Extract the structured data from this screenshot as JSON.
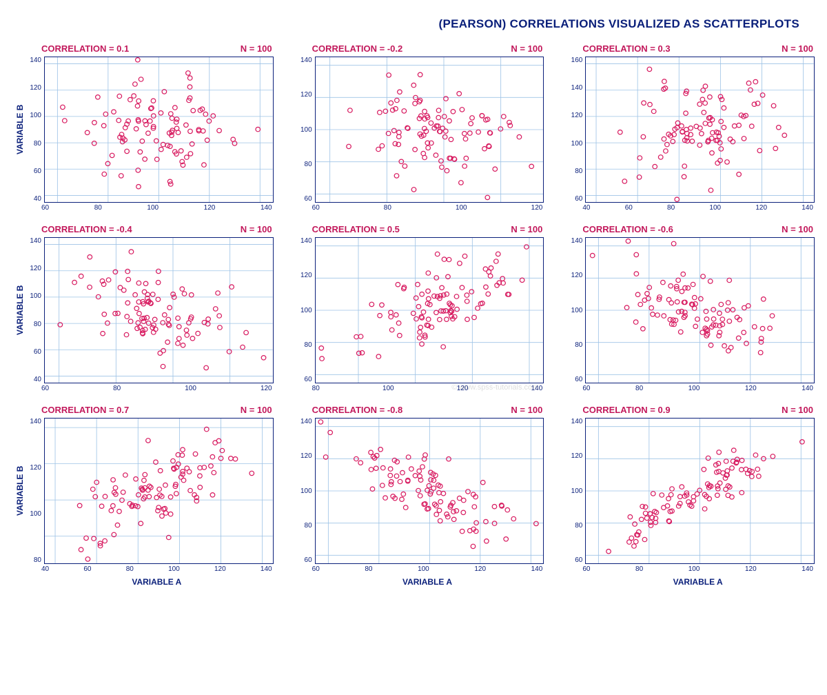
{
  "colors": {
    "text_primary": "#0a1f7a",
    "accent": "#c2185b",
    "grid": "#9ec3e6",
    "point_stroke": "#d81b60"
  },
  "main_title": "(PEARSON) CORRELATIONS VISUALIZED AS SCATTERPLOTS",
  "global_xlabel": "VARIABLE A",
  "global_ylabel": "VARIABLE B",
  "watermark": "© www.spss-tutorials.com",
  "chart_data": [
    {
      "type": "scatter",
      "title_left": "CORRELATION = 0.1",
      "title_right": "N = 100",
      "correlation": 0.1,
      "n": 100,
      "xlabel": "VARIABLE A",
      "ylabel": "VARIABLE B",
      "xlim": [
        55,
        145
      ],
      "ylim": [
        35,
        145
      ],
      "xticks": [
        60,
        80,
        100,
        120,
        140
      ],
      "yticks": [
        40,
        60,
        80,
        100,
        120,
        140
      ]
    },
    {
      "type": "scatter",
      "title_left": "CORRELATION = -0.2",
      "title_right": "N = 100",
      "correlation": -0.2,
      "n": 100,
      "xlabel": "VARIABLE A",
      "ylabel": "VARIABLE B",
      "xlim": [
        55,
        135
      ],
      "ylim": [
        55,
        145
      ],
      "xticks": [
        60,
        80,
        100,
        120
      ],
      "yticks": [
        60,
        80,
        100,
        120,
        140
      ]
    },
    {
      "type": "scatter",
      "title_left": "CORRELATION = 0.3",
      "title_right": "N = 100",
      "correlation": 0.3,
      "n": 100,
      "xlabel": "VARIABLE A",
      "ylabel": "VARIABLE B",
      "xlim": [
        35,
        145
      ],
      "ylim": [
        55,
        165
      ],
      "xticks": [
        40,
        60,
        80,
        100,
        120,
        140
      ],
      "yticks": [
        60,
        80,
        100,
        120,
        140,
        160
      ]
    },
    {
      "type": "scatter",
      "title_left": "CORRELATION = -0.4",
      "title_right": "N = 100",
      "correlation": -0.4,
      "n": 100,
      "xlabel": "VARIABLE A",
      "ylabel": "VARIABLE B",
      "xlim": [
        55,
        135
      ],
      "ylim": [
        35,
        145
      ],
      "xticks": [
        60,
        80,
        100,
        120
      ],
      "yticks": [
        40,
        60,
        80,
        100,
        120,
        140
      ]
    },
    {
      "type": "scatter",
      "title_left": "CORRELATION = 0.5",
      "title_right": "N = 100",
      "correlation": 0.5,
      "n": 100,
      "xlabel": "VARIABLE A",
      "ylabel": "VARIABLE B",
      "xlim": [
        65,
        145
      ],
      "ylim": [
        55,
        145
      ],
      "xticks": [
        80,
        100,
        120,
        140
      ],
      "yticks": [
        60,
        80,
        100,
        120,
        140
      ]
    },
    {
      "type": "scatter",
      "title_left": "CORRELATION = -0.6",
      "title_right": "N = 100",
      "correlation": -0.6,
      "n": 100,
      "xlabel": "VARIABLE A",
      "ylabel": "VARIABLE B",
      "xlim": [
        55,
        145
      ],
      "ylim": [
        55,
        145
      ],
      "xticks": [
        60,
        80,
        100,
        120,
        140
      ],
      "yticks": [
        60,
        80,
        100,
        120,
        140
      ]
    },
    {
      "type": "scatter",
      "title_left": "CORRELATION = 0.7",
      "title_right": "N = 100",
      "correlation": 0.7,
      "n": 100,
      "xlabel": "VARIABLE A",
      "ylabel": "VARIABLE B",
      "xlim": [
        35,
        145
      ],
      "ylim": [
        65,
        145
      ],
      "xticks": [
        40,
        60,
        80,
        100,
        120,
        140
      ],
      "yticks": [
        80,
        100,
        120,
        140
      ]
    },
    {
      "type": "scatter",
      "title_left": "CORRELATION = -0.8",
      "title_right": "N = 100",
      "correlation": -0.8,
      "n": 100,
      "xlabel": "VARIABLE A",
      "ylabel": "VARIABLE B",
      "xlim": [
        55,
        145
      ],
      "ylim": [
        55,
        145
      ],
      "xticks": [
        60,
        80,
        100,
        120,
        140
      ],
      "yticks": [
        60,
        80,
        100,
        120,
        140
      ]
    },
    {
      "type": "scatter",
      "title_left": "CORRELATION = 0.9",
      "title_right": "N = 100",
      "correlation": 0.9,
      "n": 100,
      "xlabel": "VARIABLE A",
      "ylabel": "VARIABLE B",
      "xlim": [
        55,
        145
      ],
      "ylim": [
        55,
        145
      ],
      "xticks": [
        60,
        80,
        100,
        120,
        140
      ],
      "yticks": [
        60,
        80,
        100,
        120,
        140
      ]
    }
  ]
}
